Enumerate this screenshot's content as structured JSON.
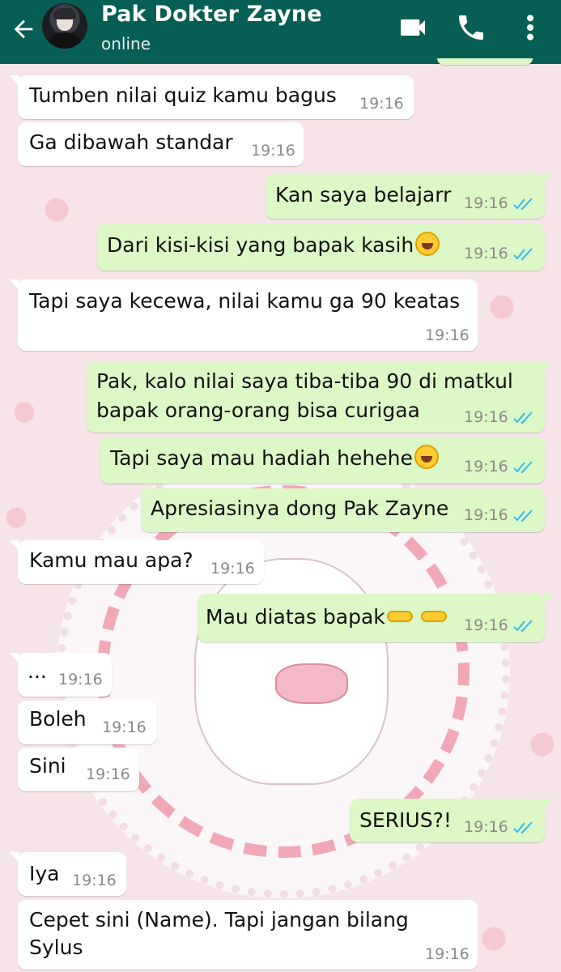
{
  "header": {
    "contact_name": "Pak Dokter Zayne",
    "status": "online",
    "icons": [
      "back-arrow-icon",
      "avatar",
      "video-call-icon",
      "phone-call-icon",
      "more-options-icon"
    ],
    "colors": {
      "bar": "#075e54",
      "text": "#ffffff"
    }
  },
  "messages": [
    {
      "dir": "in",
      "text": "Tumben nilai quiz kamu bagus",
      "time": "19:16"
    },
    {
      "dir": "in",
      "text": "Ga dibawah standar",
      "time": "19:16"
    },
    {
      "dir": "out",
      "text": "Kan saya belajarr",
      "time": "19:16"
    },
    {
      "dir": "out",
      "text": "Dari kisi-kisi yang bapak kasih",
      "time": "19:16",
      "emoji": "laughing-face"
    },
    {
      "dir": "in",
      "text": "Tapi saya kecewa, nilai kamu ga 90 keatas",
      "time": "19:16"
    },
    {
      "dir": "out",
      "text": "Pak, kalo nilai saya tiba-tiba 90 di matkul",
      "text2": "bapak orang-orang bisa curigaa",
      "time": "19:16"
    },
    {
      "dir": "out",
      "text": "Tapi saya mau hadiah hehehe",
      "time": "19:16",
      "emoji": "grinning-face"
    },
    {
      "dir": "out",
      "text": "Apresiasinya dong Pak Zayne",
      "time": "19:16"
    },
    {
      "dir": "in",
      "text": "Kamu mau apa?",
      "time": "19:16"
    },
    {
      "dir": "out",
      "text": "Mau diatas bapak",
      "time": "19:16",
      "emoji": "pointing-fingers"
    },
    {
      "dir": "in",
      "text": "...",
      "time": "19:16"
    },
    {
      "dir": "in",
      "text": "Boleh",
      "time": "19:16"
    },
    {
      "dir": "in",
      "text": "Sini",
      "time": "19:16"
    },
    {
      "dir": "out",
      "text": "SERIUS?!",
      "time": "19:16"
    },
    {
      "dir": "in",
      "text": "Iya",
      "time": "19:16"
    },
    {
      "dir": "in",
      "text": "Cepet sini (Name). Tapi jangan bilang",
      "text2": "Sylus",
      "time": "19:16"
    }
  ],
  "colors": {
    "incoming": "#ffffff",
    "outgoing": "#dcf8c6",
    "read_ticks": "#34b7f1",
    "time": "#8a8a8a"
  }
}
